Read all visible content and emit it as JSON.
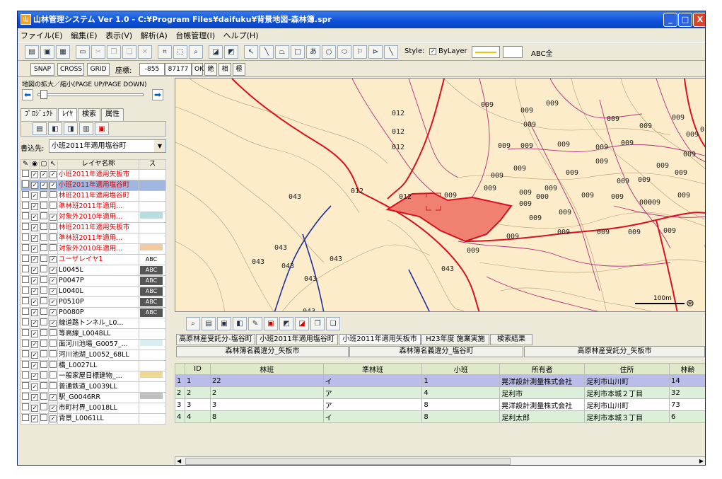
{
  "window": {
    "title": "山林管理システム Ver 1.0 - C:¥Program Files¥daifuku¥背景地図-森林簿.spr",
    "minimize": "_",
    "maximize": "□",
    "close": "X"
  },
  "menu": [
    "ファイル(E)",
    "編集(E)",
    "表示(V)",
    "解析(A)",
    "台帳管理(I)",
    "ヘルプ(H)"
  ],
  "toolbar": {
    "style_label": "Style:",
    "bylayer": "ByLayer",
    "abc_label": "ABC全"
  },
  "snapbar": {
    "snap": "SNAP",
    "cross": "CROSS",
    "grid": "GRID",
    "coord_label": "座標:",
    "x": "-855",
    "y": "87177",
    "ok": "OK",
    "abs": "絶",
    "rel": "相",
    "polar": "極"
  },
  "left": {
    "zoom_label": "地図の拡大／縮小(PAGE UP/PAGE DOWN)",
    "tabs": [
      "ﾌﾟﾛｼﾞｪｸﾄ",
      "ﾚｲﾔ",
      "検索",
      "属性"
    ],
    "write_label": "書込先:",
    "write_target": "小班2011年適用塩谷町",
    "col_name": "レイヤ名称",
    "col_style": "ス",
    "layers": [
      {
        "name": "小班2011年適用矢板市",
        "red": true,
        "sel": false
      },
      {
        "name": "小班2011年適用塩谷町",
        "red": true,
        "sel": true
      },
      {
        "name": "林班2011年適用塩谷町",
        "red": true,
        "sel": false
      },
      {
        "name": "準林班2011年適用...",
        "red": true,
        "sel": false
      },
      {
        "name": "対象外2010年適用...",
        "red": true,
        "sel": false,
        "sw": "#b8dde0"
      },
      {
        "name": "林班2011年適用矢板市",
        "red": true,
        "sel": false
      },
      {
        "name": "準林班2011年適用...",
        "red": true,
        "sel": false
      },
      {
        "name": "対象外2010年適用...",
        "red": true,
        "sel": false,
        "sw": "#f4c8a0"
      },
      {
        "name": "ユーザレイヤ1",
        "red": true,
        "sel": false,
        "abc": "ABC"
      },
      {
        "name": "L0045L",
        "red": false,
        "sel": false,
        "abc": "ABC"
      },
      {
        "name": "P0047P",
        "red": false,
        "sel": false,
        "abc": "ABC"
      },
      {
        "name": "L0040L",
        "red": false,
        "sel": false,
        "abc": "ABC"
      },
      {
        "name": "P0510P",
        "red": false,
        "sel": false,
        "abc": "ABC"
      },
      {
        "name": "P0080P",
        "red": false,
        "sel": false,
        "abc": "ABC"
      },
      {
        "name": "線道路トンネル_L0...",
        "red": false,
        "sel": false
      },
      {
        "name": "等高線_L0048LL",
        "red": false,
        "sel": false
      },
      {
        "name": "面河川池場_G0057_...",
        "red": false,
        "sel": false,
        "sw": "#d8eef0"
      },
      {
        "name": "河川池湖_L0052_68LL",
        "red": false,
        "sel": false
      },
      {
        "name": "橋_L0027LL",
        "red": false,
        "sel": false
      },
      {
        "name": "一般家屋日標建物_...",
        "red": false,
        "sel": false,
        "sw": "#f0d890"
      },
      {
        "name": "普通鉄道_L0039LL",
        "red": false,
        "sel": false
      },
      {
        "name": "駅_G0046RR",
        "red": false,
        "sel": false,
        "sw": "#c0c0c0"
      },
      {
        "name": "市町村界_L0018LL",
        "red": false,
        "sel": false
      },
      {
        "name": "背景_L0061LL",
        "red": false,
        "sel": false
      }
    ]
  },
  "map": {
    "scale": "100m",
    "labels": [
      "012",
      "012",
      "012",
      "012",
      "012",
      "009",
      "009",
      "009",
      "009",
      "009",
      "009",
      "009",
      "009",
      "009",
      "009",
      "009",
      "009",
      "009",
      "009",
      "009",
      "009",
      "009",
      "009",
      "009",
      "009",
      "009",
      "009",
      "009",
      "009",
      "009",
      "009",
      "009",
      "009",
      "009",
      "009",
      "009",
      "009",
      "009",
      "009",
      "009",
      "009",
      "009",
      "009",
      "009",
      "010",
      "043",
      "043",
      "043",
      "043",
      "043",
      "043",
      "043",
      "043",
      "000",
      "000",
      "0"
    ]
  },
  "lower": {
    "tabs1": [
      "高原林産受託分-塩谷町",
      "小班2011年適用塩谷町",
      "小班2011年適用矢板市",
      "H23年度 施業実施",
      "検索結果"
    ],
    "tabs2": [
      "森林簿名義違分_矢板市",
      "森林簿名義違分_塩谷町",
      "高原林産受託分_矢板市"
    ],
    "columns": [
      "",
      "ID",
      "林班",
      "準林班",
      "小班",
      "所有者",
      "住所",
      "林齢"
    ],
    "rows": [
      [
        "1",
        "1",
        "22",
        "イ",
        "1",
        "晃洋設計測量株式会社",
        "足利市山川町",
        "14"
      ],
      [
        "2",
        "2",
        "2",
        "ア",
        "4",
        "足利市",
        "足利市本城２丁目",
        "32"
      ],
      [
        "3",
        "3",
        "3",
        "ア",
        "8",
        "晃洋設計測量株式会社",
        "足利市山川町",
        "73"
      ],
      [
        "4",
        "4",
        "8",
        "イ",
        "8",
        "足利太郎",
        "足利市本城３丁目",
        "6"
      ]
    ]
  }
}
